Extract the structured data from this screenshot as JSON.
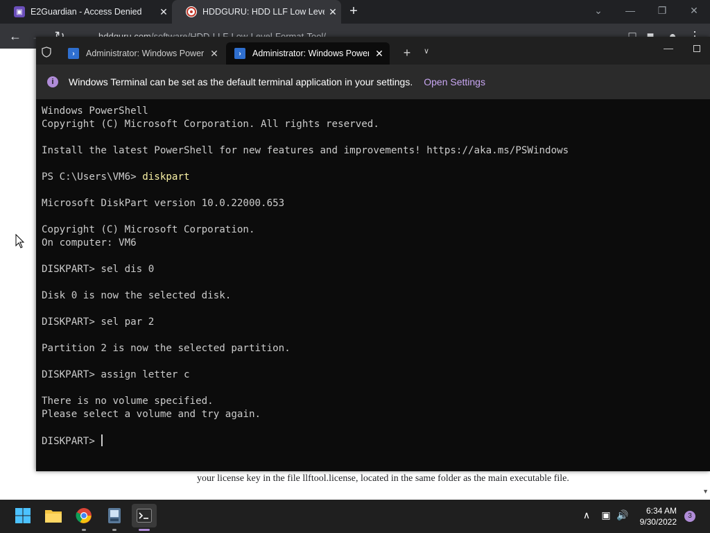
{
  "browser": {
    "tabs": [
      {
        "title": "E2Guardian - Access Denied",
        "favicon": "e2guardian-icon",
        "color": "#6b4fbb"
      },
      {
        "title": "HDDGURU: HDD LLF Low Level F",
        "favicon": "hddguru-icon",
        "color": "#c0392b"
      }
    ],
    "new_tab_label": "+",
    "url_host": "hddguru.com",
    "url_path": "/software/HDD-LLF-Low-Level-Format-Tool/",
    "page_text": "your license key in the file llftool.license, located in the same folder as the main executable file."
  },
  "terminal": {
    "tabs": [
      {
        "title": "Administrator: Windows PowerShell",
        "active": false
      },
      {
        "title": "Administrator: Windows PowerShell",
        "active": true
      }
    ],
    "infobar": {
      "message": "Windows Terminal can be set as the default terminal application in your settings.",
      "link": "Open Settings"
    },
    "lines": [
      {
        "text": "Windows PowerShell"
      },
      {
        "text": "Copyright (C) Microsoft Corporation. All rights reserved."
      },
      {
        "text": ""
      },
      {
        "text": "Install the latest PowerShell for new features and improvements! https://aka.ms/PSWindows"
      },
      {
        "text": ""
      },
      {
        "prompt": "PS C:\\Users\\VM6> ",
        "cmd": "diskpart"
      },
      {
        "text": ""
      },
      {
        "text": "Microsoft DiskPart version 10.0.22000.653"
      },
      {
        "text": ""
      },
      {
        "text": "Copyright (C) Microsoft Corporation."
      },
      {
        "text": "On computer: VM6"
      },
      {
        "text": ""
      },
      {
        "text": "DISKPART> sel dis 0"
      },
      {
        "text": ""
      },
      {
        "text": "Disk 0 is now the selected disk."
      },
      {
        "text": ""
      },
      {
        "text": "DISKPART> sel par 2"
      },
      {
        "text": ""
      },
      {
        "text": "Partition 2 is now the selected partition."
      },
      {
        "text": ""
      },
      {
        "text": "DISKPART> assign letter c"
      },
      {
        "text": ""
      },
      {
        "text": "There is no volume specified."
      },
      {
        "text": "Please select a volume and try again."
      },
      {
        "text": ""
      },
      {
        "text": "DISKPART> ",
        "caret": true
      }
    ]
  },
  "taskbar": {
    "time": "6:34 AM",
    "date": "9/30/2022",
    "notification_count": "3"
  },
  "colors": {
    "terminal_bg": "#0c0c0c",
    "terminal_text": "#cccccc",
    "command_text": "#f9f1a5",
    "accent_purple": "#c8a6f2"
  }
}
